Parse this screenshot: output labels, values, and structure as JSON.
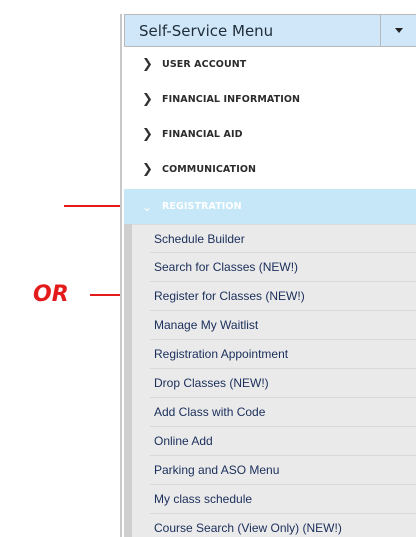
{
  "annotation": {
    "or_text": "OR"
  },
  "menu": {
    "title": "Self-Service Menu",
    "toggle_icon": "caret-down-icon",
    "sections": [
      {
        "label": "USER ACCOUNT",
        "icon": "chevron-right-icon"
      },
      {
        "label": "FINANCIAL INFORMATION",
        "icon": "chevron-right-icon"
      },
      {
        "label": "FINANCIAL AID",
        "icon": "chevron-right-icon"
      },
      {
        "label": "COMMUNICATION",
        "icon": "chevron-right-icon"
      },
      {
        "label": "REGISTRATION",
        "icon": "chevron-down-icon",
        "expanded": true
      }
    ],
    "registration_items": [
      "Schedule Builder",
      "Search for Classes (NEW!)",
      "Register for Classes (NEW!)",
      "Manage My Waitlist",
      "Registration Appointment",
      "Drop Classes (NEW!)",
      "Add Class with Code",
      "Online Add",
      "Parking and ASO Menu",
      "My class schedule",
      "Course Search (View Only) (NEW!)"
    ]
  },
  "colors": {
    "annotation_red": "#e31b1b",
    "header_bg": "#cfe7f8",
    "active_section_bg": "#c6e7f8",
    "submenu_bg": "#eaeaea",
    "submenu_text": "#1a2e5a"
  }
}
